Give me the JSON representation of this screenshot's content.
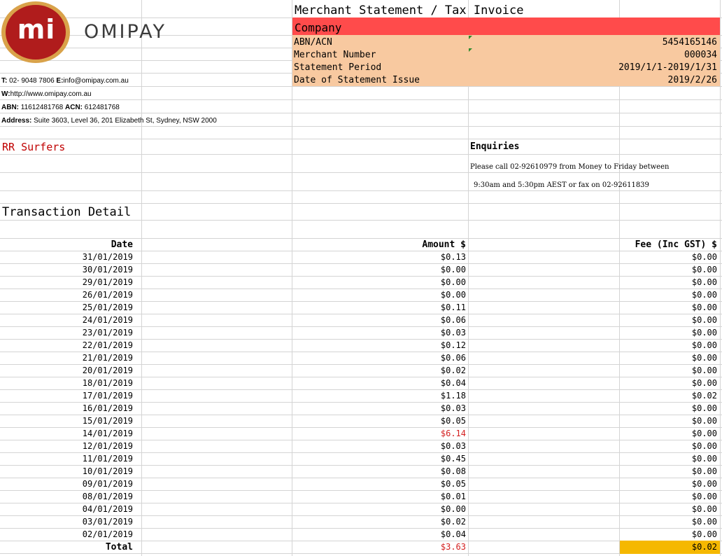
{
  "header": {
    "title": "Merchant Statement / Tax Invoice",
    "company_label": "Company",
    "rows": [
      {
        "label": "ABN/ACN",
        "value": "5454165146"
      },
      {
        "label": "Merchant Number",
        "value": "000034"
      },
      {
        "label": "Statement Period",
        "value": "2019/1/1-2019/1/31"
      },
      {
        "label": "Date of Statement Issue",
        "value": "2019/2/26"
      }
    ]
  },
  "logo": {
    "mark": "mi",
    "wordmark": "OMIPAY"
  },
  "contact": {
    "phone_label": "T:",
    "phone": "02- 9048 7806",
    "email_label": "E:",
    "email": "info@omipay.com.au",
    "web_label": "W:",
    "web": "http://www.omipay.com.au",
    "abn_label": "ABN:",
    "abn": "11612481768",
    "acn_label": "ACN:",
    "acn": "612481768",
    "address_label": "Address:",
    "address": "Suite 3603, Level 36, 201 Elizabeth St, Sydney, NSW 2000"
  },
  "merchant_name": "RR Surfers",
  "enquiries": {
    "title": "Enquiries",
    "line1": "Please call 02-92610979 from Money to Friday between",
    "line2": "9:30am and 5:30pm AEST or fax on 02-92611839"
  },
  "section_title": "Transaction Detail",
  "table": {
    "headers": [
      "Date",
      "Amount $",
      "Fee (Inc GST) $"
    ],
    "rows": [
      {
        "date": "31/01/2019",
        "amount": "$0.13",
        "fee": "$0.00"
      },
      {
        "date": "30/01/2019",
        "amount": "$0.00",
        "fee": "$0.00"
      },
      {
        "date": "29/01/2019",
        "amount": "$0.00",
        "fee": "$0.00"
      },
      {
        "date": "26/01/2019",
        "amount": "$0.00",
        "fee": "$0.00"
      },
      {
        "date": "25/01/2019",
        "amount": "$0.11",
        "fee": "$0.00"
      },
      {
        "date": "24/01/2019",
        "amount": "$0.06",
        "fee": "$0.00"
      },
      {
        "date": "23/01/2019",
        "amount": "$0.03",
        "fee": "$0.00"
      },
      {
        "date": "22/01/2019",
        "amount": "$0.12",
        "fee": "$0.00"
      },
      {
        "date": "21/01/2019",
        "amount": "$0.06",
        "fee": "$0.00"
      },
      {
        "date": "20/01/2019",
        "amount": "$0.02",
        "fee": "$0.00"
      },
      {
        "date": "18/01/2019",
        "amount": "$0.04",
        "fee": "$0.00"
      },
      {
        "date": "17/01/2019",
        "amount": "$1.18",
        "fee": "$0.02"
      },
      {
        "date": "16/01/2019",
        "amount": "$0.03",
        "fee": "$0.00"
      },
      {
        "date": "15/01/2019",
        "amount": "$0.05",
        "fee": "$0.00"
      },
      {
        "date": "14/01/2019",
        "amount": "$6.14",
        "fee": "$0.00",
        "highlight": true
      },
      {
        "date": "12/01/2019",
        "amount": "$0.03",
        "fee": "$0.00"
      },
      {
        "date": "11/01/2019",
        "amount": "$0.45",
        "fee": "$0.00"
      },
      {
        "date": "10/01/2019",
        "amount": "$0.08",
        "fee": "$0.00"
      },
      {
        "date": "09/01/2019",
        "amount": "$0.05",
        "fee": "$0.00"
      },
      {
        "date": "08/01/2019",
        "amount": "$0.01",
        "fee": "$0.00"
      },
      {
        "date": "04/01/2019",
        "amount": "$0.00",
        "fee": "$0.00"
      },
      {
        "date": "03/01/2019",
        "amount": "$0.02",
        "fee": "$0.00"
      },
      {
        "date": "02/01/2019",
        "amount": "$0.04",
        "fee": "$0.00"
      }
    ],
    "total_label": "Total",
    "total_amount": "$3.63",
    "total_fee": "$0.02"
  },
  "colors": {
    "company_bar": "#ff4b4b",
    "info_bg": "#f8c9a0",
    "highlight_text": "#d42020",
    "total_fee_bg": "#f5b800",
    "merchant_name": "#c00000"
  }
}
